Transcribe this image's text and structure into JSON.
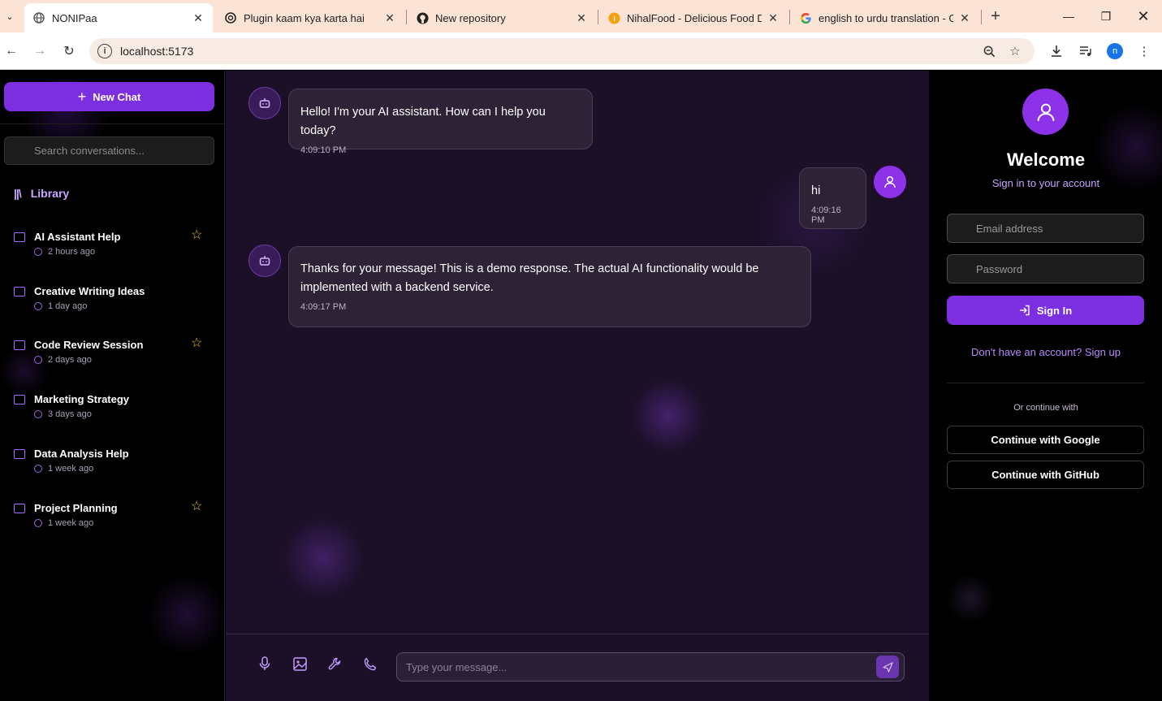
{
  "browser": {
    "tabs": [
      {
        "title": "NONIPaa",
        "active": true
      },
      {
        "title": "Plugin kaam kya karta hai",
        "active": false
      },
      {
        "title": "New repository",
        "active": false
      },
      {
        "title": "NihalFood - Delicious Food Del",
        "active": false
      },
      {
        "title": "english to urdu translation - Go",
        "active": false
      }
    ],
    "url": "localhost:5173",
    "profile_initial": "n"
  },
  "sidebar": {
    "new_chat_label": "New Chat",
    "search_placeholder": "Search conversations...",
    "library_label": "Library",
    "conversations": [
      {
        "title": "AI Assistant Help",
        "time": "2 hours ago",
        "starred": true
      },
      {
        "title": "Creative Writing Ideas",
        "time": "1 day ago",
        "starred": false
      },
      {
        "title": "Code Review Session",
        "time": "2 days ago",
        "starred": true
      },
      {
        "title": "Marketing Strategy",
        "time": "3 days ago",
        "starred": false
      },
      {
        "title": "Data Analysis Help",
        "time": "1 week ago",
        "starred": false
      },
      {
        "title": "Project Planning",
        "time": "1 week ago",
        "starred": true
      }
    ]
  },
  "chat": {
    "messages": [
      {
        "role": "assistant",
        "text": "Hello! I'm your AI assistant. How can I help you today?",
        "time": "4:09:10 PM"
      },
      {
        "role": "user",
        "text": "hi",
        "time": "4:09:16 PM"
      },
      {
        "role": "assistant",
        "text": "Thanks for your message! This is a demo response. The actual AI functionality would be implemented with a backend service.",
        "time": "4:09:17 PM"
      }
    ],
    "input_placeholder": "Type your message..."
  },
  "auth": {
    "title": "Welcome",
    "subtitle": "Sign in to your account",
    "email_placeholder": "Email address",
    "password_placeholder": "Password",
    "signin_label": "Sign In",
    "signup_text": "Don't have an account? Sign up",
    "divider_text": "Or continue with",
    "google_label": "Continue with Google",
    "github_label": "Continue with GitHub"
  },
  "colors": {
    "accent": "#7c2fe0",
    "chat_bg": "#1c1029",
    "star": "#e9c440"
  }
}
